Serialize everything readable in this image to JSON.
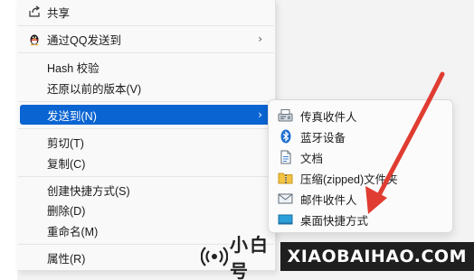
{
  "menu": {
    "share": "共享",
    "qq_send": "通过QQ发送到",
    "hash": "Hash 校验",
    "restore": "还原以前的版本(V)",
    "send_to": "发送到(N)",
    "cut": "剪切(T)",
    "copy": "复制(C)",
    "create_shortcut": "创建快捷方式(S)",
    "delete": "删除(D)",
    "rename": "重命名(M)",
    "properties": "属性(R)"
  },
  "submenu": {
    "fax": "传真收件人",
    "bluetooth": "蓝牙设备",
    "documents": "文档",
    "zip": "压缩(zipped)文件夹",
    "mail": "邮件收件人",
    "desktop": "桌面快捷方式"
  },
  "watermark": {
    "cn_text": "小白号",
    "en_text": "XIAOBAIHAO.COM"
  },
  "colors": {
    "highlight": "#0a64d2",
    "arrow": "#e03c31"
  },
  "icons": {
    "share": "share-icon",
    "qq": "qq-penguin-icon",
    "fax": "fax-icon",
    "bluetooth": "bluetooth-icon",
    "documents": "document-icon",
    "zip": "zip-folder-icon",
    "mail": "mail-icon",
    "desktop": "desktop-icon"
  }
}
